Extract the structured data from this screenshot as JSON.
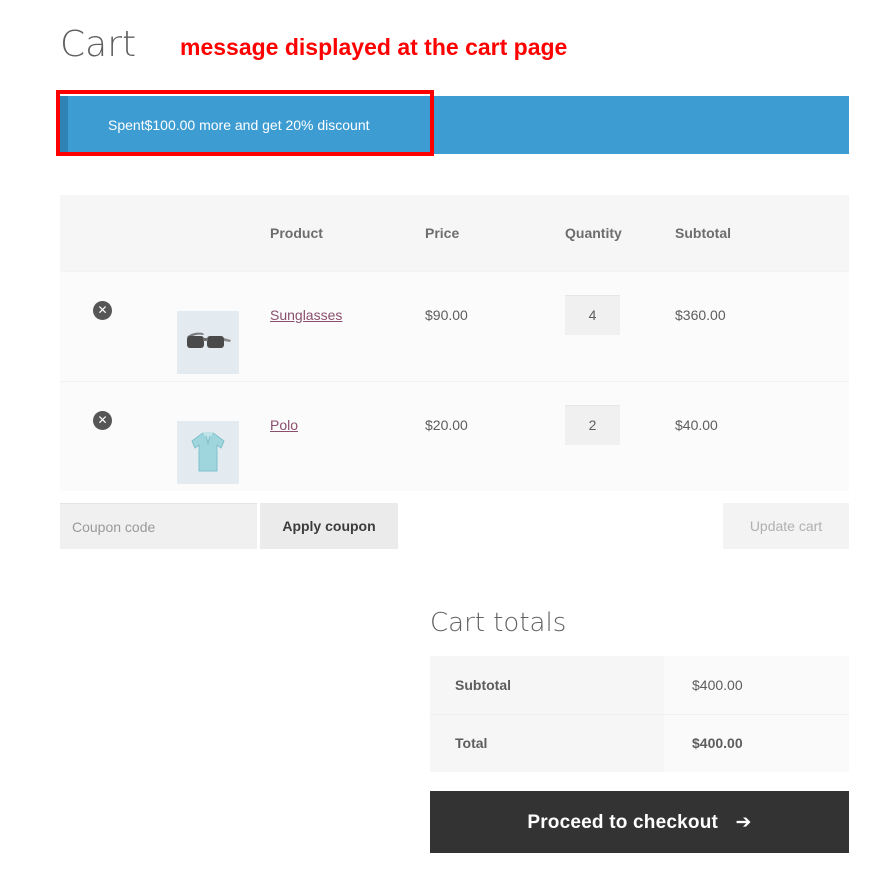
{
  "page": {
    "title": "Cart",
    "annotation": "message displayed at the cart page"
  },
  "notice": {
    "message": "Spent$100.00 more and get 20% discount",
    "background_color": "#3d9cd2",
    "border_color": "#2f82b4",
    "annotation_color": "#ff0000"
  },
  "cart_table": {
    "headers": {
      "remove": "",
      "thumbnail": "",
      "product": "Product",
      "price": "Price",
      "quantity": "Quantity",
      "subtotal": "Subtotal"
    },
    "rows": [
      {
        "remove_label": "✕",
        "thumb_icon": "sunglasses-thumbnail",
        "name": "Sunglasses",
        "price": "$90.00",
        "quantity": "4",
        "subtotal": "$360.00"
      },
      {
        "remove_label": "✕",
        "thumb_icon": "polo-shirt-thumbnail",
        "name": "Polo",
        "price": "$20.00",
        "quantity": "2",
        "subtotal": "$40.00"
      }
    ]
  },
  "actions": {
    "coupon_value": "",
    "coupon_placeholder": "Coupon code",
    "apply_coupon_label": "Apply coupon",
    "update_cart_label": "Update cart"
  },
  "totals": {
    "title": "Cart totals",
    "rows": [
      {
        "label": "Subtotal",
        "value": "$400.00"
      },
      {
        "label": "Total",
        "value": "$400.00"
      }
    ],
    "checkout_label": "Proceed to checkout",
    "checkout_arrow": "➔"
  }
}
